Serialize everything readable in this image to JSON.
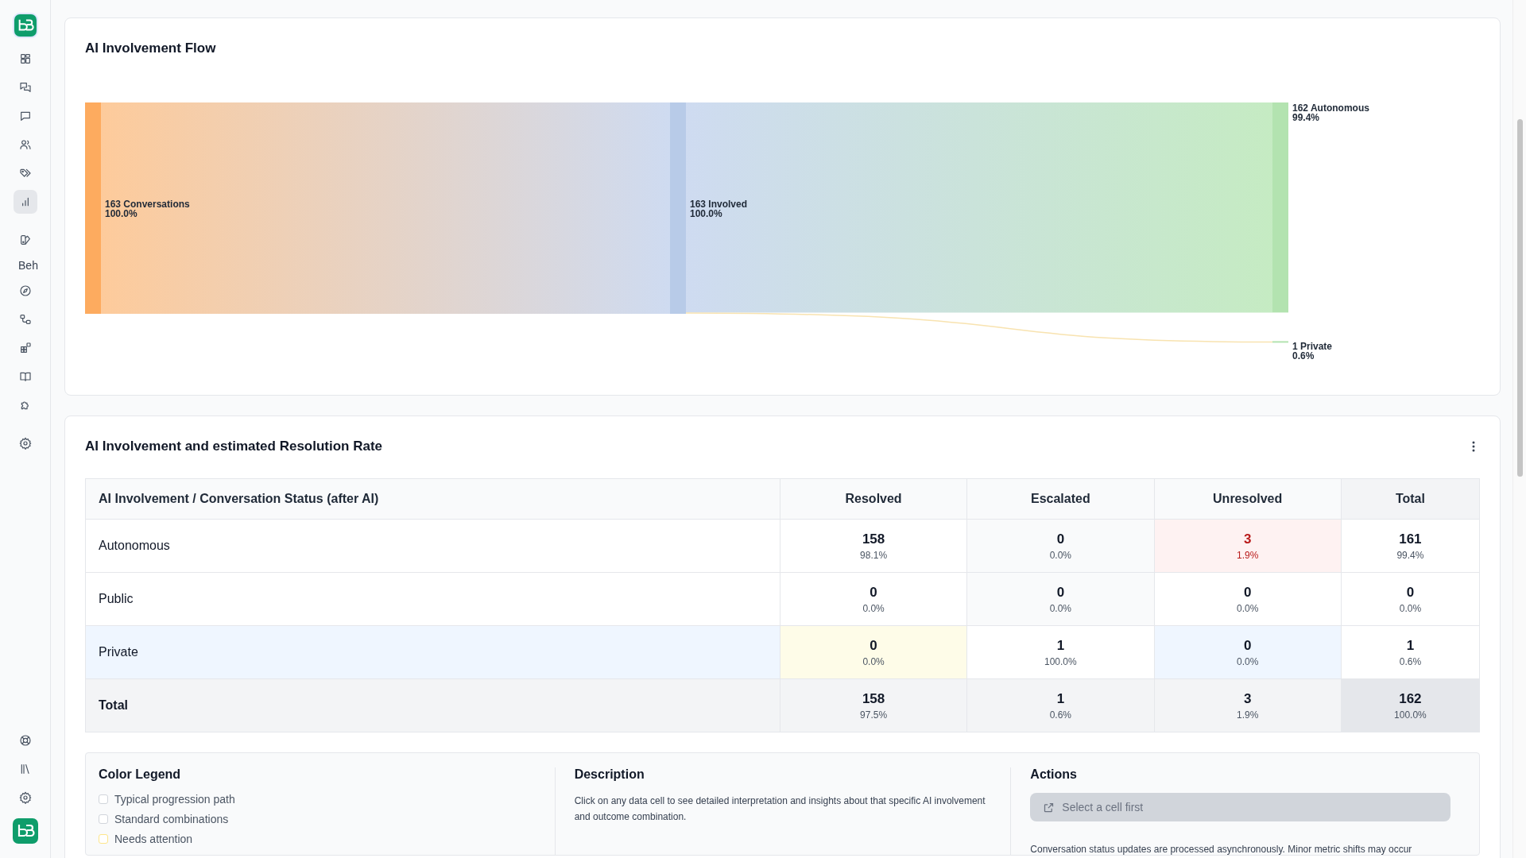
{
  "sidebar": {
    "top_items": [
      {
        "kind": "grid",
        "selected": false
      },
      {
        "kind": "chats",
        "selected": false
      },
      {
        "kind": "chat",
        "selected": false
      },
      {
        "kind": "users",
        "selected": false
      },
      {
        "kind": "tags",
        "selected": false
      },
      {
        "kind": "chart",
        "selected": true
      },
      {
        "kind": "divider"
      },
      {
        "kind": "palette",
        "selected": false
      },
      {
        "kind": "text",
        "label": "Beh"
      },
      {
        "kind": "compass",
        "selected": false
      },
      {
        "kind": "workflow",
        "selected": false
      },
      {
        "kind": "apps",
        "selected": false
      },
      {
        "kind": "book",
        "selected": false
      },
      {
        "kind": "puzzle",
        "selected": false
      },
      {
        "kind": "divider"
      },
      {
        "kind": "gear",
        "selected": false
      }
    ],
    "bottom_items": [
      {
        "kind": "help"
      },
      {
        "kind": "library"
      },
      {
        "kind": "gear"
      }
    ]
  },
  "flow": {
    "title": "AI Involvement Flow",
    "nodes": [
      {
        "kind": "source",
        "name": "163 Conversations",
        "percent": "100.0%"
      },
      {
        "kind": "stage",
        "name": "163 Involved",
        "percent": "100.0%"
      },
      {
        "kind": "outcome",
        "name": "162 Autonomous",
        "percent": "99.4%"
      },
      {
        "kind": "outcome",
        "name": "1 Private",
        "percent": "0.6%"
      }
    ]
  },
  "matrix": {
    "title": "AI Involvement and estimated Resolution Rate",
    "corner_header": "AI Involvement / Conversation Status (after AI)",
    "columns": [
      "Resolved",
      "Escalated",
      "Unresolved",
      "Total"
    ],
    "rows": [
      {
        "label": "Autonomous",
        "kind": "body",
        "cells": [
          {
            "value": "158",
            "percent": "98.1%",
            "kind": "plain"
          },
          {
            "value": "0",
            "percent": "0.0%",
            "kind": "muted"
          },
          {
            "value": "3",
            "percent": "1.9%",
            "kind": "alert"
          },
          {
            "value": "161",
            "percent": "99.4%",
            "kind": "plain"
          }
        ]
      },
      {
        "label": "Public",
        "kind": "body",
        "cells": [
          {
            "value": "0",
            "percent": "0.0%",
            "kind": "plain"
          },
          {
            "value": "0",
            "percent": "0.0%",
            "kind": "muted"
          },
          {
            "value": "0",
            "percent": "0.0%",
            "kind": "plain"
          },
          {
            "value": "0",
            "percent": "0.0%",
            "kind": "plain"
          }
        ]
      },
      {
        "label": "Private",
        "kind": "highlight",
        "cells": [
          {
            "value": "0",
            "percent": "0.0%",
            "kind": "attention"
          },
          {
            "value": "1",
            "percent": "100.0%",
            "kind": "plain"
          },
          {
            "value": "0",
            "percent": "0.0%",
            "kind": "highlight"
          },
          {
            "value": "1",
            "percent": "0.6%",
            "kind": "plain"
          }
        ]
      },
      {
        "label": "Total",
        "kind": "total",
        "cells": [
          {
            "value": "158",
            "percent": "97.5%",
            "kind": "plain"
          },
          {
            "value": "1",
            "percent": "0.6%",
            "kind": "plain"
          },
          {
            "value": "3",
            "percent": "1.9%",
            "kind": "plain"
          },
          {
            "value": "162",
            "percent": "100.0%",
            "kind": "grand"
          }
        ]
      }
    ]
  },
  "legend": {
    "title": "Color Legend",
    "items": [
      {
        "label": "Typical progression path",
        "color": "#d1d5db"
      },
      {
        "label": "Standard combinations",
        "color": "#d1d5db"
      },
      {
        "label": "Needs attention",
        "color": "#fde68a"
      }
    ]
  },
  "description": {
    "title": "Description",
    "text": "Click on any data cell to see detailed interpretation and insights about that specific AI involvement and outcome combination."
  },
  "actions": {
    "title": "Actions",
    "button": {
      "label": "Select a cell first",
      "disabled": true
    },
    "note": "Conversation status updates are processed asynchronously. Minor metric shifts may occur"
  }
}
